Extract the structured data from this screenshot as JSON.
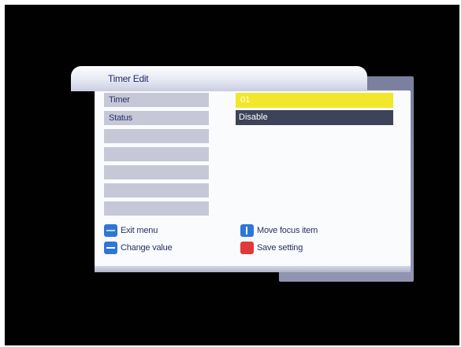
{
  "dialog": {
    "title": "Timer Edit"
  },
  "fields": [
    {
      "label": "Timer",
      "value": "01"
    },
    {
      "label": "Status",
      "value": "Disable"
    },
    {
      "label": ""
    },
    {
      "label": ""
    },
    {
      "label": ""
    },
    {
      "label": ""
    },
    {
      "label": ""
    }
  ],
  "legend": {
    "exit": "Exit menu",
    "change": "Change value",
    "move": "Move focus item",
    "save": "Save setting"
  },
  "colors": {
    "highlight": "#f2e72a",
    "selected_value": "#3d4458",
    "label_bg": "#c6c8d7",
    "text": "#2b2f6a"
  },
  "icons": {
    "exit": "menu-key-icon",
    "change": "left-right-key-icon",
    "move": "up-down-key-icon",
    "save": "red-key-icon"
  }
}
